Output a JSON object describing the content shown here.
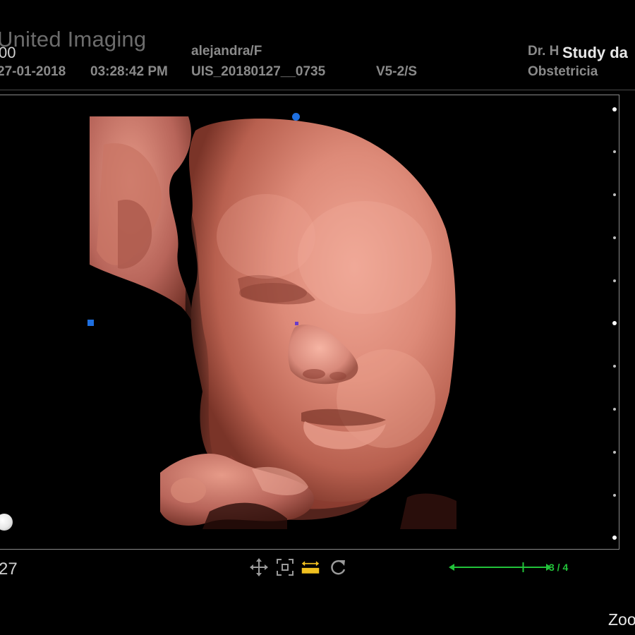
{
  "header": {
    "brand": "United Imaging",
    "row1_left": "00",
    "patient": "alejandra/F",
    "doctor": "Dr. H",
    "study_label": "Study da",
    "date": "27-01-2018",
    "time": "03:28:42 PM",
    "study_id": "UIS_20180127__0735",
    "probe": "V5-2/S",
    "department": "Obstetricia"
  },
  "footer": {
    "frame_index": "27",
    "progress": {
      "label": "3 / 4",
      "fraction": 0.75,
      "color": "#22c23a"
    },
    "zoom_label": "Zoo"
  },
  "toolbar": {
    "icons": [
      "move-icon",
      "fit-icon",
      "scale-icon",
      "rotate-icon"
    ],
    "highlight_color": "#f0c020"
  },
  "colors": {
    "marker": "#1e6fe0",
    "marker_center": "#6a3cc8",
    "skin": "#d98a78"
  }
}
